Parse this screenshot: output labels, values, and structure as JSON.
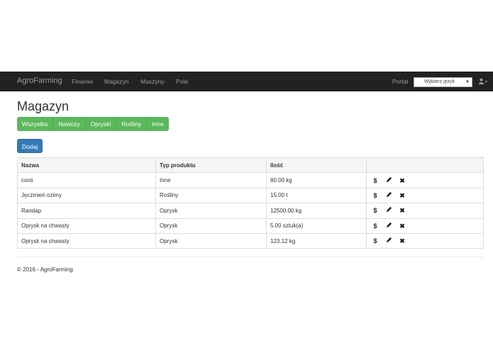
{
  "navbar": {
    "brand": "AgroFarming",
    "links": [
      "Finanse",
      "Magazyn",
      "Maszyny",
      "Pola"
    ],
    "portal": "Portal",
    "language_select": "Wybierz język"
  },
  "page": {
    "title": "Magazyn"
  },
  "filters": [
    "Wszystko",
    "Nawozy",
    "Opryski",
    "Rośliny",
    "Inne"
  ],
  "add_label": "Dodaj",
  "table": {
    "headers": [
      "Nazwa",
      "Typ produktu",
      "Ilość",
      ""
    ],
    "rows": [
      {
        "name": "cooś",
        "type": "Inne",
        "qty": "80.00 kg"
      },
      {
        "name": "Jęczmień ozimy",
        "type": "Rośliny",
        "qty": "15.00 t"
      },
      {
        "name": "Randap",
        "type": "Oprysk",
        "qty": "12500.00 kg"
      },
      {
        "name": "Oprysk na chwasty",
        "type": "Oprysk",
        "qty": "5.00 sztuk(a)"
      },
      {
        "name": "Oprysk na chwasty",
        "type": "Oprysk",
        "qty": "123.12 kg"
      }
    ],
    "action_icons": {
      "price": "$",
      "edit": "pencil-icon",
      "delete": "✖"
    }
  },
  "footer": "© 2016 - AgroFarming"
}
